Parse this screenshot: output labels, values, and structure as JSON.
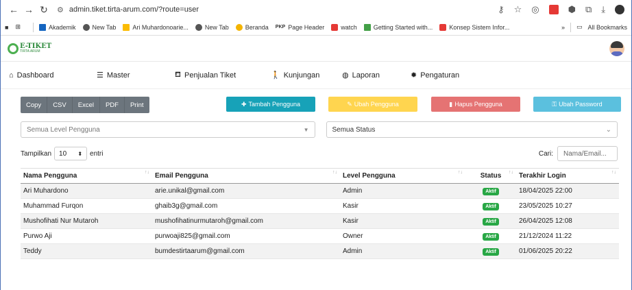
{
  "browser": {
    "url": "admin.tiket.tirta-arum.com/?route=user",
    "bookmarks": [
      "Akademik",
      "New Tab",
      "Ari Muhardonoarie...",
      "New Tab",
      "Beranda",
      "Page Header",
      "watch",
      "Getting Started with...",
      "Konsep Sistem Infor..."
    ],
    "more": "»",
    "all_bookmarks": "All Bookmarks"
  },
  "app": {
    "logo_main": "E-TIKET",
    "logo_sub": "TIRTA ARUM"
  },
  "menu": [
    "Dashboard",
    "Master",
    "Penjualan Tiket",
    "Kunjungan",
    "Laporan",
    "Pengaturan"
  ],
  "export_buttons": [
    "Copy",
    "CSV",
    "Excel",
    "PDF",
    "Print"
  ],
  "actions": {
    "add": "Tambah Pengguna",
    "edit": "Ubah Pengguna",
    "delete": "Hapus Pengguna",
    "password": "Ubah Password"
  },
  "colors": {
    "add": "#17a2b8",
    "edit": "#ffd54f",
    "delete": "#e57373",
    "password": "#5bc0de",
    "badge": "#28a745"
  },
  "filters": {
    "level_placeholder": "Semua Level Pengguna",
    "status": "Semua Status"
  },
  "length": {
    "prefix": "Tampilkan",
    "value": "10",
    "suffix": "entri"
  },
  "search": {
    "label": "Cari:",
    "placeholder": "Nama/Email..."
  },
  "table": {
    "headers": [
      "Nama Pengguna",
      "Email Pengguna",
      "Level Pengguna",
      "Status",
      "Terakhir Login"
    ],
    "rows": [
      [
        "Ari Muhardono",
        "arie.unikal@gmail.com",
        "Admin",
        "Aktif",
        "18/04/2025 22:00"
      ],
      [
        "Muhammad Furqon",
        "ghaib3g@gmail.com",
        "Kasir",
        "Aktif",
        "23/05/2025 10:27"
      ],
      [
        "Mushofihati Nur Mutaroh",
        "mushofihatinurmutaroh@gmail.com",
        "Kasir",
        "Aktif",
        "26/04/2025 12:08"
      ],
      [
        "Purwo Aji",
        "purwoaji825@gmail.com",
        "Owner",
        "Aktif",
        "21/12/2024 11:22"
      ],
      [
        "Teddy",
        "bumdestirtaarum@gmail.com",
        "Admin",
        "Aktif",
        "01/06/2025 20:22"
      ]
    ]
  }
}
